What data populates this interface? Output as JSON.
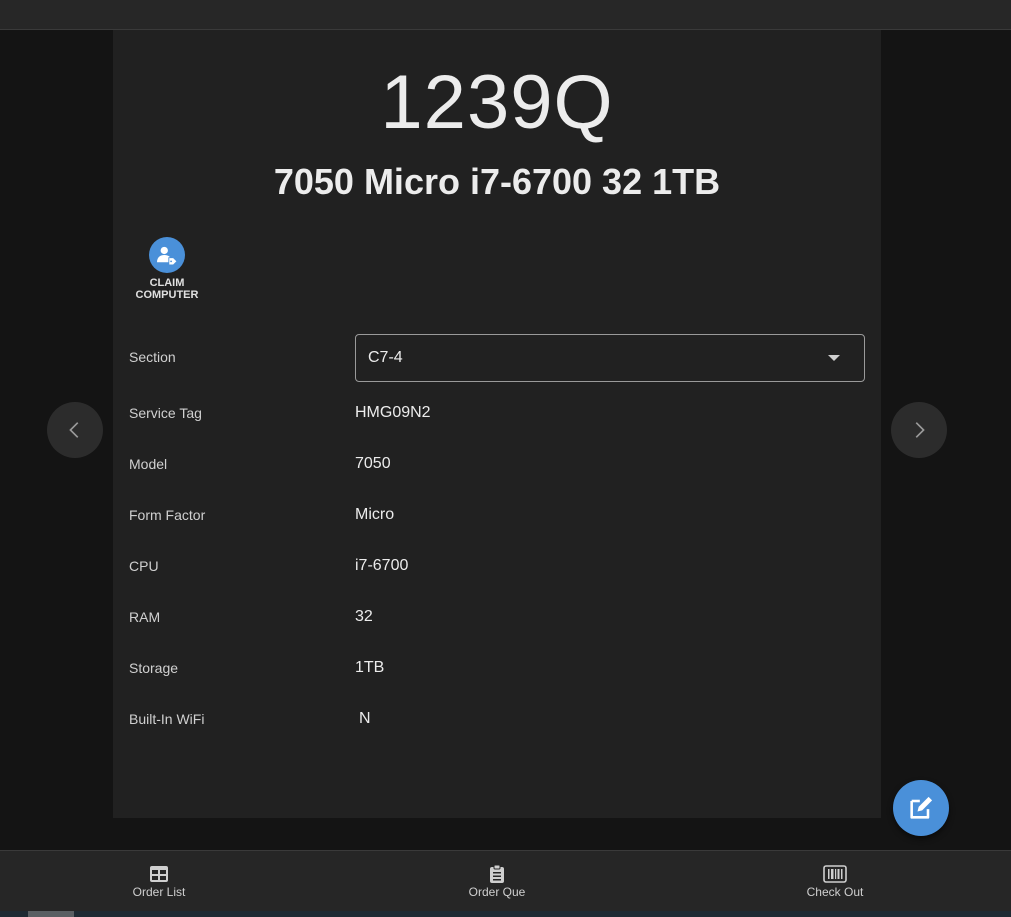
{
  "asset": {
    "id": "1239Q",
    "description": "7050 Micro i7-6700 32 1TB"
  },
  "claim": {
    "label": "CLAIM\nCOMPUTER",
    "icon": "user-tag-icon"
  },
  "details": {
    "section": {
      "label": "Section",
      "value": "C7-4"
    },
    "service_tag": {
      "label": "Service Tag",
      "value": "HMG09N2"
    },
    "model": {
      "label": "Model",
      "value": "7050"
    },
    "form_factor": {
      "label": "Form Factor",
      "value": "Micro"
    },
    "cpu": {
      "label": "CPU",
      "value": "i7-6700"
    },
    "ram": {
      "label": "RAM",
      "value": "32"
    },
    "storage": {
      "label": "Storage",
      "value": "1TB"
    },
    "wifi": {
      "label": "Built-In WiFi",
      "value": "N"
    }
  },
  "nav": {
    "prev_icon": "chevron-left-icon",
    "next_icon": "chevron-right-icon",
    "edit_icon": "edit-icon"
  },
  "bottom_nav": [
    {
      "label": "Order List",
      "icon": "table-icon"
    },
    {
      "label": "Order Que",
      "icon": "clipboard-list-icon"
    },
    {
      "label": "Check Out",
      "icon": "barcode-icon"
    }
  ],
  "colors": {
    "accent": "#4a90d9",
    "card": "#212121",
    "background": "#141414"
  }
}
